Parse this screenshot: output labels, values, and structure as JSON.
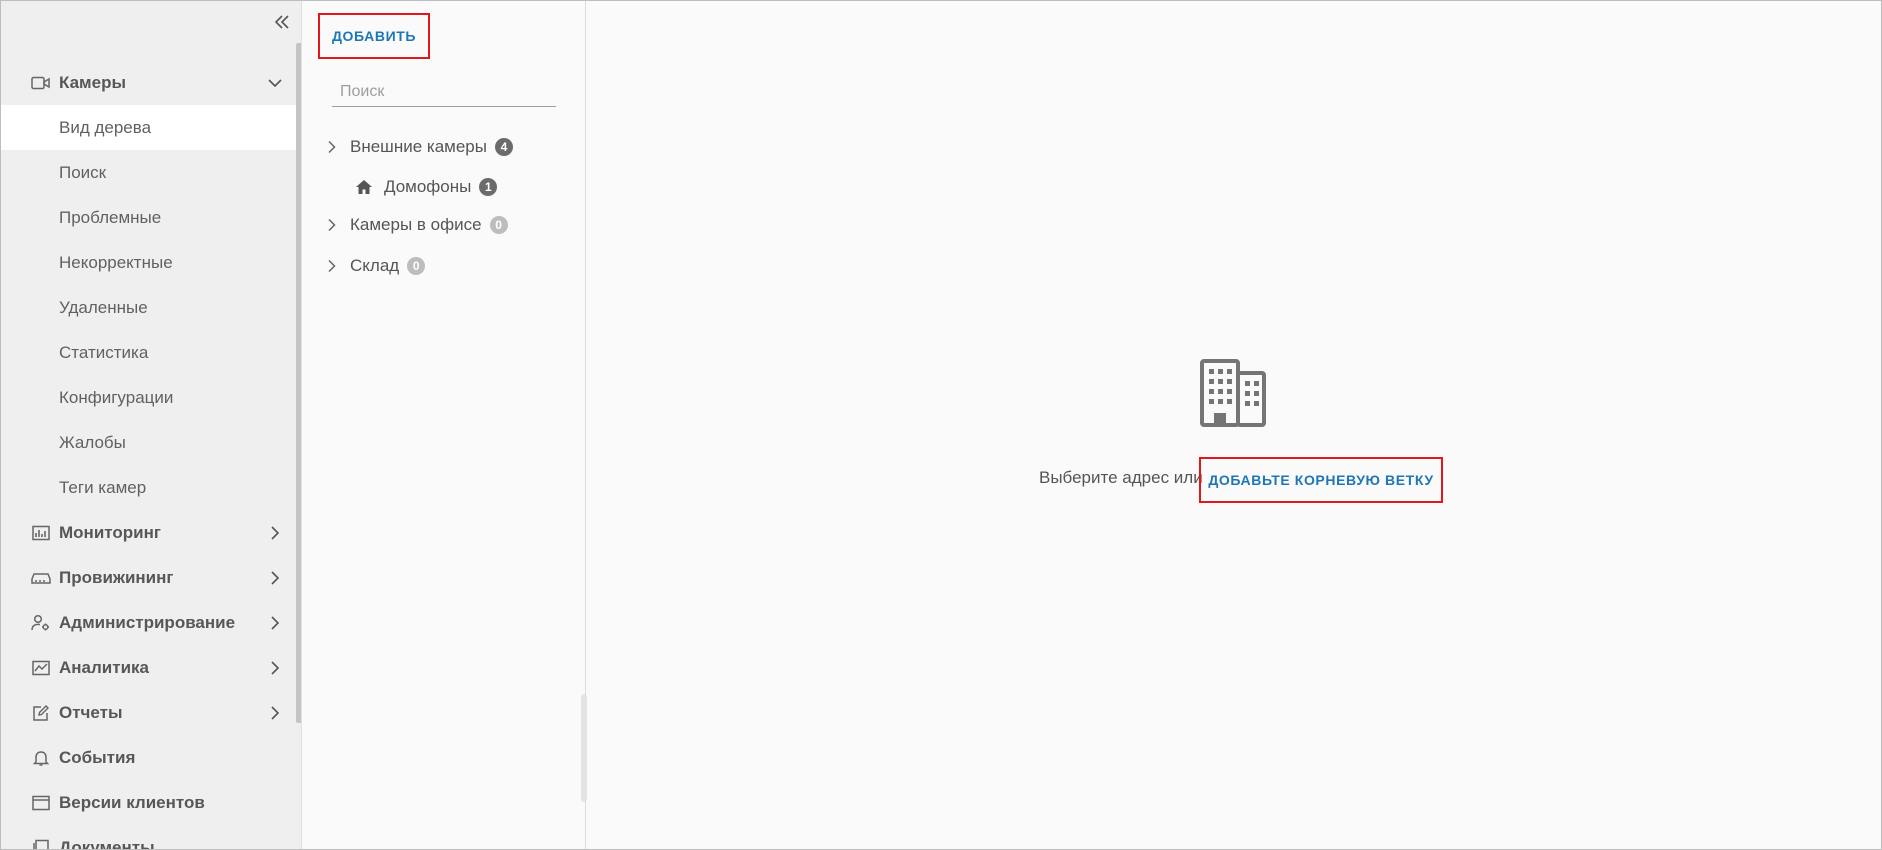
{
  "sidebar": {
    "collapse_icon": "double-chevron-left-icon",
    "items": [
      {
        "label": "Камеры",
        "icon": "camera-icon",
        "expanded": true
      },
      {
        "label": "Вид дерева",
        "active": true
      },
      {
        "label": "Поиск"
      },
      {
        "label": "Проблемные"
      },
      {
        "label": "Некорректные"
      },
      {
        "label": "Удаленные"
      },
      {
        "label": "Статистика"
      },
      {
        "label": "Конфигурации"
      },
      {
        "label": "Жалобы"
      },
      {
        "label": "Теги камер"
      },
      {
        "label": "Мониторинг",
        "icon": "chart-icon"
      },
      {
        "label": "Провижининг",
        "icon": "router-icon"
      },
      {
        "label": "Администрирование",
        "icon": "user-settings-icon"
      },
      {
        "label": "Аналитика",
        "icon": "analytics-icon"
      },
      {
        "label": "Отчеты",
        "icon": "edit-report-icon"
      },
      {
        "label": "События",
        "icon": "bell-icon"
      },
      {
        "label": "Версии клиентов",
        "icon": "window-icon"
      },
      {
        "label": "Документы",
        "icon": "documents-icon"
      }
    ]
  },
  "tree": {
    "add_label": "ДОБАВИТЬ",
    "search_placeholder": "Поиск",
    "nodes": [
      {
        "label": "Внешние камеры",
        "count": "4"
      },
      {
        "label": "Домофоны",
        "count": "1",
        "icon": "home-icon"
      },
      {
        "label": "Камеры в офисе",
        "count": "0"
      },
      {
        "label": "Склад",
        "count": "0"
      }
    ]
  },
  "main": {
    "empty_icon": "building-icon",
    "prompt": "Выберите адрес или",
    "add_root_label": "ДОБАВЬТЕ КОРНЕВУЮ ВЕТКУ"
  },
  "colors": {
    "accent": "#1e77b4",
    "highlight_border": "#e4161c",
    "sidebar_bg": "#efefef",
    "active_item_bg": "#ffffff"
  }
}
